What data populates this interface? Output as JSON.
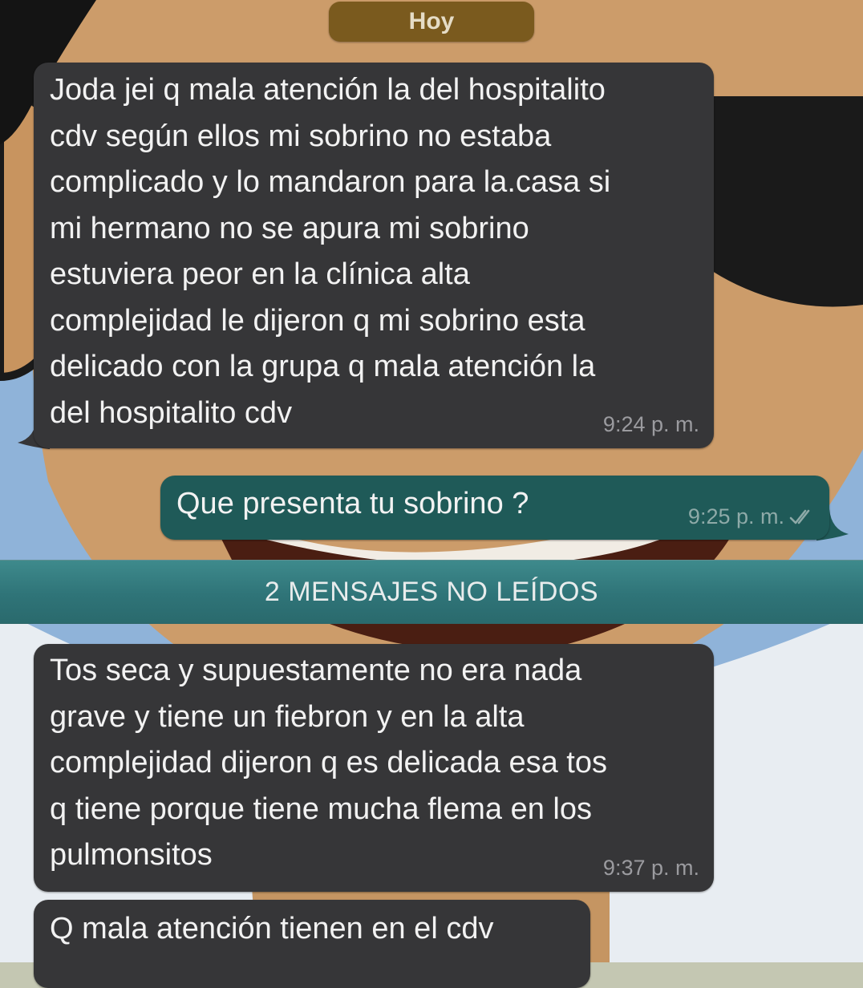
{
  "chat": {
    "date_separator": "Hoy",
    "unread_divider": "2 MENSAJES NO LEÍDOS",
    "messages": [
      {
        "direction": "incoming",
        "text": "Joda jei q mala atención la del hospitalito\ncdv según ellos mi sobrino no estaba\ncomplicado y lo mandaron para la.casa si\nmi hermano no se apura mi sobrino\nestuviera peor en la clínica alta\ncomplejidad le dijeron q mi sobrino esta\ndelicado con la grupa q mala atención la\ndel hospitalito cdv",
        "time": "9:24 p. m."
      },
      {
        "direction": "outgoing",
        "text": "Que presenta tu sobrino ?",
        "time": "9:25 p. m.",
        "status": "read",
        "status_icon": "double-check-icon"
      },
      {
        "direction": "incoming",
        "text": "Tos seca y supuestamente no era nada\ngrave y tiene un fiebron y en la alta\ncomplejidad dijeron q es delicada esa tos\nq tiene porque tiene mucha flema en los\npulmonsitos",
        "time": "9:37 p. m."
      },
      {
        "direction": "incoming",
        "text": "Q mala atención tienen en el cdv"
      }
    ]
  },
  "colors": {
    "incoming_bubble": "#363638",
    "outgoing_bubble": "#1f5a58",
    "date_pill": "#7a5a1e",
    "unread_bar": "#2f7478"
  }
}
